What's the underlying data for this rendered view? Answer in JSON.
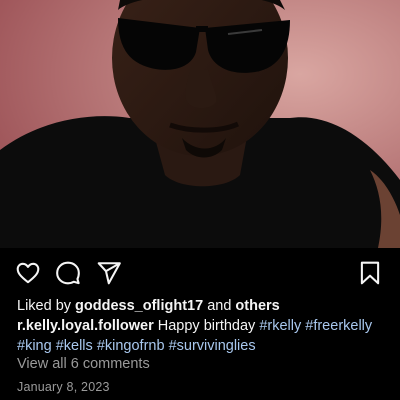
{
  "post": {
    "photo_alt": "portrait-photo",
    "liked_by_prefix": "Liked by",
    "liked_by_user": "goddess_oflight17",
    "liked_by_and": "and",
    "liked_by_others": "others",
    "author": "r.kelly.loyal.follower",
    "caption_text": "Happy birthday",
    "hashtags": [
      "#rkelly",
      "#freerkelly",
      "#king",
      "#kells",
      "#kingofrnb",
      "#survivinglies"
    ],
    "view_comments": "View all 6 comments",
    "date": "January 8, 2023"
  },
  "actions": {
    "like_icon": "heart-icon",
    "comment_icon": "comment-bubble-icon",
    "share_icon": "paper-plane-icon",
    "save_icon": "bookmark-icon"
  },
  "colors": {
    "background": "#000000",
    "text": "#f5f5f5",
    "hashtag": "#a9c8ee",
    "muted": "#9a9a9a",
    "photo_bg": "#c98a8a"
  }
}
